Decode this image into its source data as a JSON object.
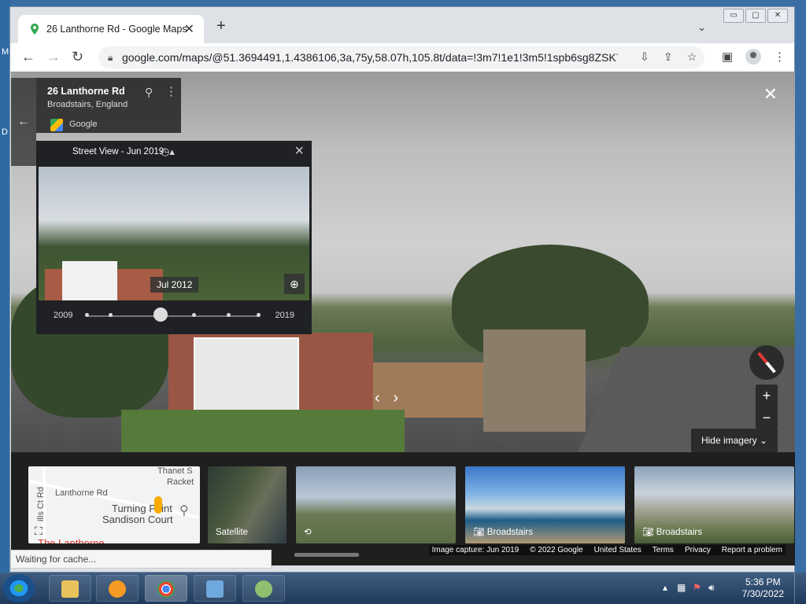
{
  "desktop": {
    "left_letters": [
      "M",
      "D"
    ]
  },
  "browser": {
    "tab_title": "26 Lanthorne Rd - Google Maps",
    "tab_close": "✕",
    "new_tab": "+",
    "tab_search": "⌄",
    "window_controls": [
      "▭",
      "▢",
      "✕"
    ],
    "url": "google.com/maps/@51.3694491,1.4386106,3a,75y,58.07h,105.8t/data=!3m7!1e1!3m5!1spb6sg8ZSK78...",
    "status_text": "Waiting for cache..."
  },
  "place": {
    "name": "26 Lanthorne Rd",
    "region": "Broadstairs, England",
    "source": "Google"
  },
  "time_machine": {
    "header": "Street View - Jun 2019",
    "date_badge": "Jul 2012",
    "year_start": "2009",
    "year_end": "2019",
    "slider_position": 0.42
  },
  "controls": {
    "hide_imagery": "Hide imagery",
    "zoom_in": "+",
    "zoom_out": "−"
  },
  "strip": {
    "map_labels": {
      "thanet": "Thanet S",
      "racket": "Racket",
      "lanthorne": "Lanthorne Rd",
      "hills": "ills Ct Rd",
      "turning": "Turning Point",
      "sandison": "Sandison Court",
      "the_lanthorne": "The Lanthorne"
    },
    "satellite": "Satellite",
    "broadstairs1": "Broadstairs",
    "broadstairs2": "Broadstairs"
  },
  "footer": {
    "capture": "Image capture: Jun 2019",
    "copyright": "© 2022 Google",
    "country": "United States",
    "terms": "Terms",
    "privacy": "Privacy",
    "report": "Report a problem"
  },
  "taskbar": {
    "time": "5:36 PM",
    "date": "7/30/2022"
  }
}
